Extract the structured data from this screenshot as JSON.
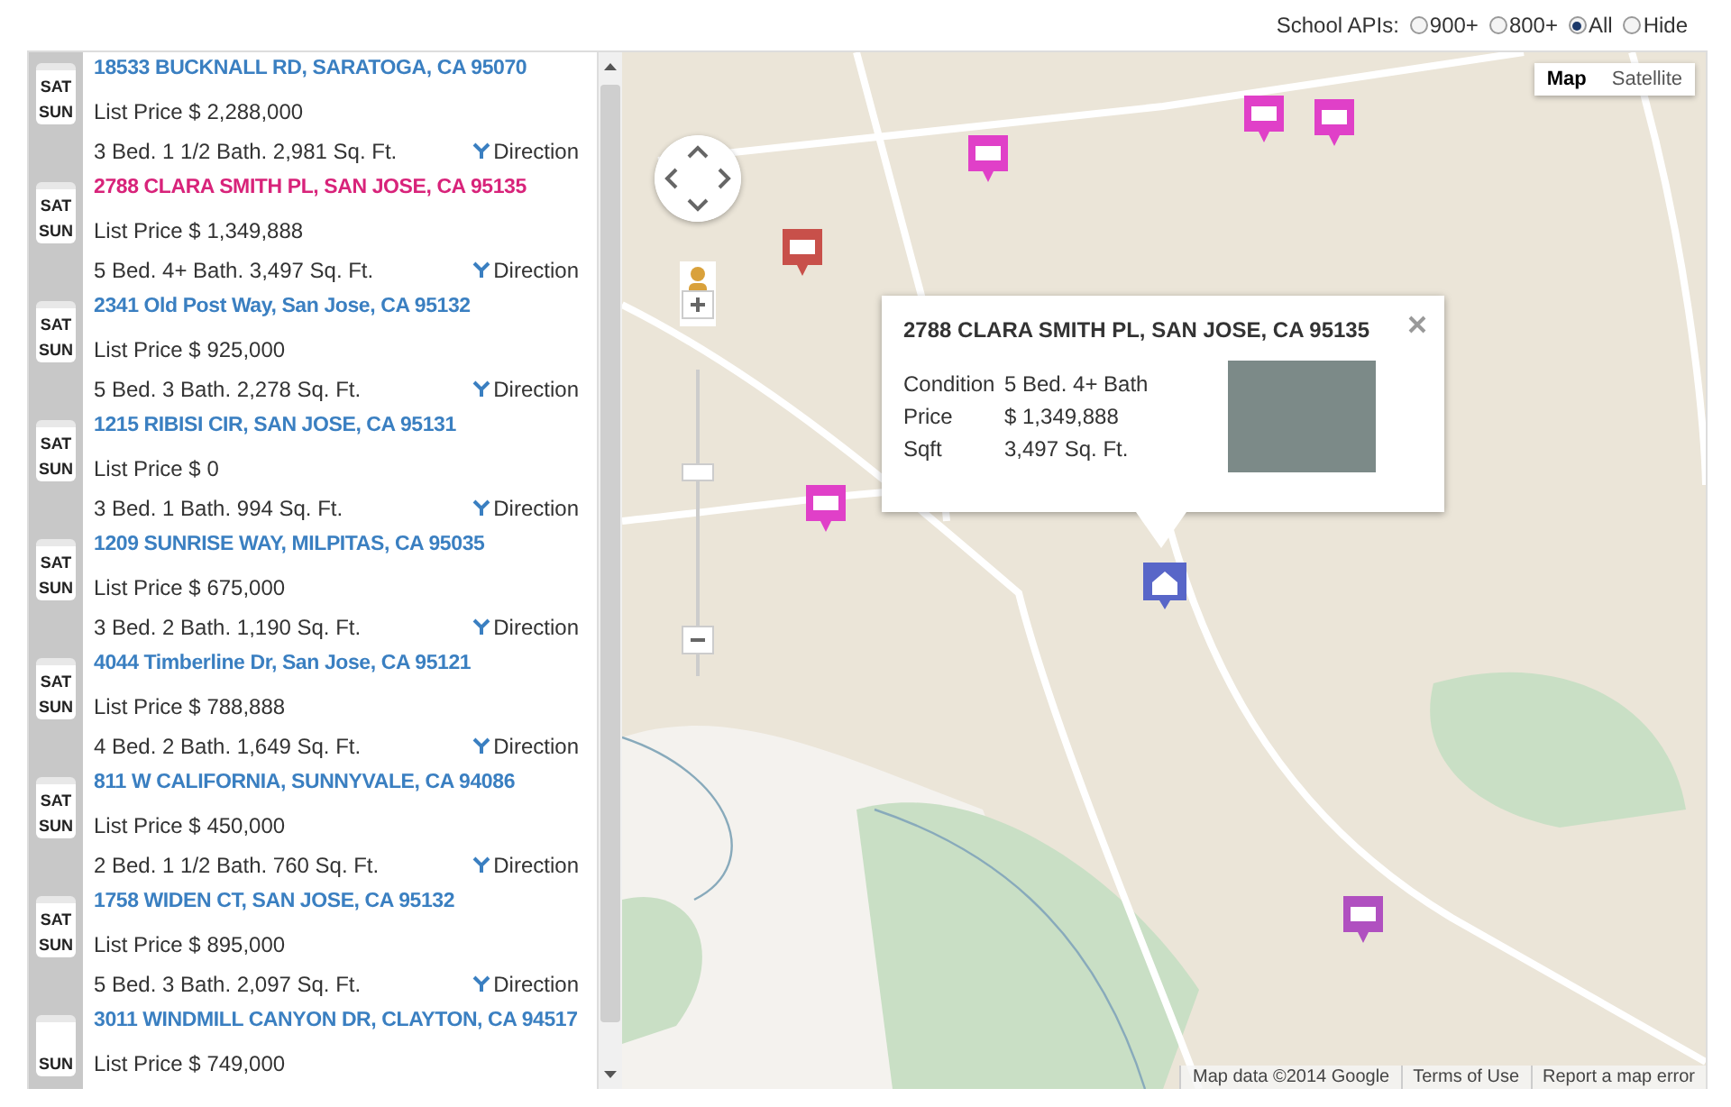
{
  "school_filter": {
    "label": "School APIs:",
    "options": [
      {
        "label": "900+",
        "selected": false
      },
      {
        "label": "800+",
        "selected": false
      },
      {
        "label": "All",
        "selected": true
      },
      {
        "label": "Hide",
        "selected": false
      }
    ]
  },
  "listings": [
    {
      "days": [
        "SAT",
        "SUN"
      ],
      "address": "18533 BUCKNALL RD, SARATOGA, CA 95070",
      "price": "List Price $ 2,288,000",
      "details": "3 Bed. 1 1/2 Bath. 2,981 Sq. Ft.",
      "direction": "Direction",
      "selected": false
    },
    {
      "days": [
        "SAT",
        "SUN"
      ],
      "address": "2788 CLARA SMITH PL, SAN JOSE, CA 95135",
      "price": "List Price $ 1,349,888",
      "details": "5 Bed. 4+ Bath. 3,497 Sq. Ft.",
      "direction": "Direction",
      "selected": true
    },
    {
      "days": [
        "SAT",
        "SUN"
      ],
      "address": "2341 Old Post Way, San Jose, CA 95132",
      "price": "List Price $ 925,000",
      "details": "5 Bed. 3 Bath. 2,278 Sq. Ft.",
      "direction": "Direction",
      "selected": false
    },
    {
      "days": [
        "SAT",
        "SUN"
      ],
      "address": "1215 RIBISI CIR, SAN JOSE, CA 95131",
      "price": "List Price $ 0",
      "details": "3 Bed. 1 Bath. 994 Sq. Ft.",
      "direction": "Direction",
      "selected": false
    },
    {
      "days": [
        "SAT",
        "SUN"
      ],
      "address": "1209 SUNRISE WAY, MILPITAS, CA 95035",
      "price": "List Price $ 675,000",
      "details": "3 Bed. 2 Bath. 1,190 Sq. Ft.",
      "direction": "Direction",
      "selected": false
    },
    {
      "days": [
        "SAT",
        "SUN"
      ],
      "address": "4044 Timberline Dr, San Jose, CA 95121",
      "price": "List Price $ 788,888",
      "details": "4 Bed. 2 Bath. 1,649 Sq. Ft.",
      "direction": "Direction",
      "selected": false
    },
    {
      "days": [
        "SAT",
        "SUN"
      ],
      "address": "811 W CALIFORNIA, SUNNYVALE, CA 94086",
      "price": "List Price $ 450,000",
      "details": "2 Bed. 1 1/2 Bath. 760 Sq. Ft.",
      "direction": "Direction",
      "selected": false
    },
    {
      "days": [
        "SAT",
        "SUN"
      ],
      "address": "1758 WIDEN CT, SAN JOSE, CA 95132",
      "price": "List Price $ 895,000",
      "details": "5 Bed. 3 Bath. 2,097 Sq. Ft.",
      "direction": "Direction",
      "selected": false
    },
    {
      "days": [
        "SUN"
      ],
      "address": "3011 WINDMILL CANYON DR, CLAYTON, CA 94517",
      "price": "List Price $ 749,000",
      "selected": false
    }
  ],
  "map": {
    "type_buttons": [
      {
        "label": "Map",
        "selected": true
      },
      {
        "label": "Satellite",
        "selected": false
      }
    ],
    "school_pins": [
      {
        "color": "#e040c8"
      },
      {
        "color": "#e040c8"
      },
      {
        "color": "#e040c8"
      },
      {
        "color": "#c8504a"
      },
      {
        "color": "#e040c8"
      },
      {
        "color": "#b050c0"
      }
    ],
    "popup": {
      "title": "2788 CLARA SMITH PL, SAN JOSE, CA 95135",
      "rows": [
        {
          "label": "Condition",
          "value": "5 Bed. 4+ Bath"
        },
        {
          "label": "Price",
          "value": "$ 1,349,888"
        },
        {
          "label": "Sqft",
          "value": "3,497 Sq. Ft."
        }
      ]
    },
    "attribution": [
      "Map data ©2014 Google",
      "Terms of Use",
      "Report a map error"
    ]
  }
}
